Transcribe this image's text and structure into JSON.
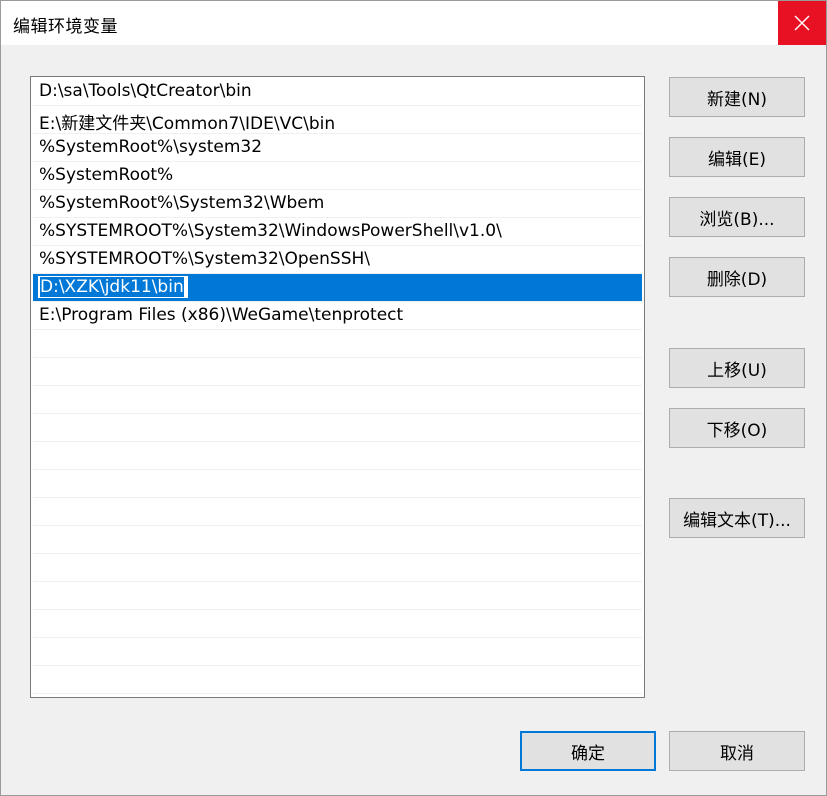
{
  "window": {
    "title": "编辑环境变量"
  },
  "list": {
    "items": [
      "D:\\sa\\Tools\\QtCreator\\bin",
      "E:\\新建文件夹\\Common7\\IDE\\VC\\bin",
      "%SystemRoot%\\system32",
      "%SystemRoot%",
      "%SystemRoot%\\System32\\Wbem",
      "%SYSTEMROOT%\\System32\\WindowsPowerShell\\v1.0\\",
      "%SYSTEMROOT%\\System32\\OpenSSH\\",
      "D:\\XZK\\jdk11\\bin",
      "E:\\Program Files (x86)\\WeGame\\tenprotect"
    ],
    "selected_index": 7,
    "editing_value": "D:\\XZK\\jdk11\\bin"
  },
  "buttons": {
    "new": "新建(N)",
    "edit": "编辑(E)",
    "browse": "浏览(B)...",
    "delete": "删除(D)",
    "move_up": "上移(U)",
    "move_down": "下移(O)",
    "edit_text": "编辑文本(T)...",
    "ok": "确定",
    "cancel": "取消"
  },
  "colors": {
    "selection": "#0078d7",
    "close_button": "#e81123"
  }
}
